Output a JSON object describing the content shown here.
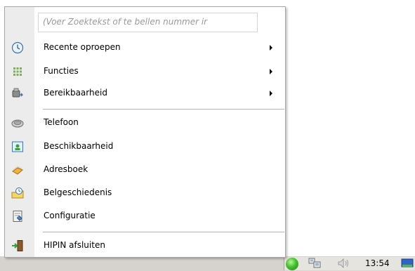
{
  "search": {
    "placeholder": "(Voer Zoektekst of te bellen nummer ir",
    "value": ""
  },
  "menu": {
    "submenu_items": [
      {
        "label": "Recente oproepen",
        "icon": "clock-icon"
      },
      {
        "label": "Functies",
        "icon": "grid-icon"
      },
      {
        "label": "Bereikbaarheid",
        "icon": "phone-forward-icon"
      }
    ],
    "main_items": [
      {
        "label": "Telefoon",
        "icon": "telephone-icon"
      },
      {
        "label": "Beschikbaarheid",
        "icon": "presence-card-icon"
      },
      {
        "label": "Adresboek",
        "icon": "address-book-icon"
      },
      {
        "label": "Belgeschiedenis",
        "icon": "call-history-icon"
      },
      {
        "label": "Configuratie",
        "icon": "configuration-icon"
      }
    ],
    "exit_item": {
      "label": "HIPIN afsluiten",
      "icon": "exit-door-icon"
    }
  },
  "tray": {
    "clock": "13:54",
    "status_color": "#42c12b"
  }
}
